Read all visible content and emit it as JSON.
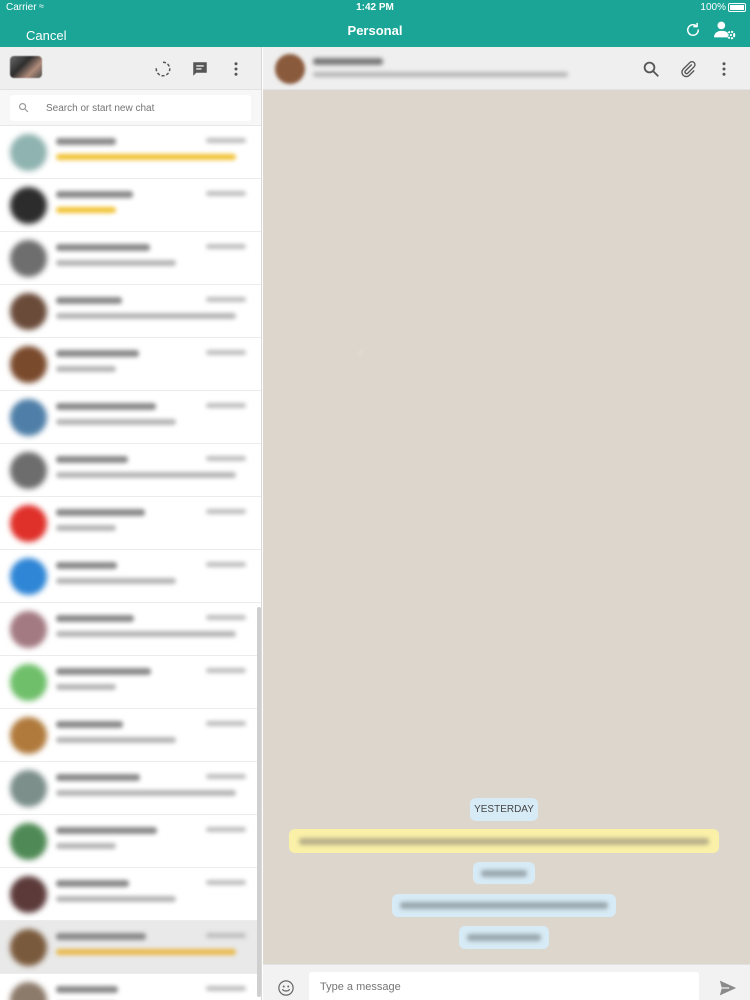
{
  "status_bar": {
    "carrier": "Carrier",
    "time": "1:42 PM",
    "battery": "100%"
  },
  "top_bar": {
    "cancel_label": "Cancel",
    "title": "Personal"
  },
  "colors": {
    "accent": "#1aa596",
    "wallpaper": "#ddd6cd",
    "date_pill": "#d7ebf6",
    "highlight_bubble": "#faf0a8"
  },
  "sidebar": {
    "search_placeholder": "Search or start new chat",
    "icons": [
      "status-icon",
      "new-chat-icon",
      "menu-icon"
    ]
  },
  "conversation": {
    "date_divider": "YESTERDAY",
    "composer_placeholder": "Type a message",
    "icons": [
      "search-icon",
      "attach-icon",
      "menu-icon",
      "emoji-icon",
      "send-icon"
    ]
  }
}
